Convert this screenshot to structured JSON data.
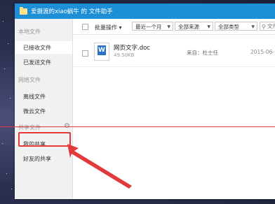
{
  "window": {
    "title": "爱摄渡的xiao蜗牛 的 文件助手"
  },
  "sidebar": {
    "sections": [
      {
        "label": "本地文件",
        "items": [
          "已接收文件",
          "已发送文件"
        ]
      },
      {
        "label": "网络文件",
        "items": [
          "离线文件",
          "微云文件"
        ]
      },
      {
        "label": "共享文件",
        "items": [
          "我的共享",
          "好友的共享"
        ]
      }
    ]
  },
  "toolbar": {
    "batch_label": "批量操作",
    "filter_time": "最近一个月",
    "filter_source": "全部来源",
    "filter_type": "全部类型",
    "search_placeholder": "文件名"
  },
  "files": [
    {
      "name": "网页文字.doc",
      "size": "49.50KB",
      "source": "来自：杜士任",
      "date": "2015-06-"
    }
  ],
  "colors": {
    "titlebar": "#1c8fd6",
    "annotation": "#e23a3a",
    "word_icon": "#2b72c6"
  },
  "icons": [
    "folder-icon",
    "gear-icon",
    "search-icon",
    "word-doc-icon",
    "caret-down-icon"
  ]
}
